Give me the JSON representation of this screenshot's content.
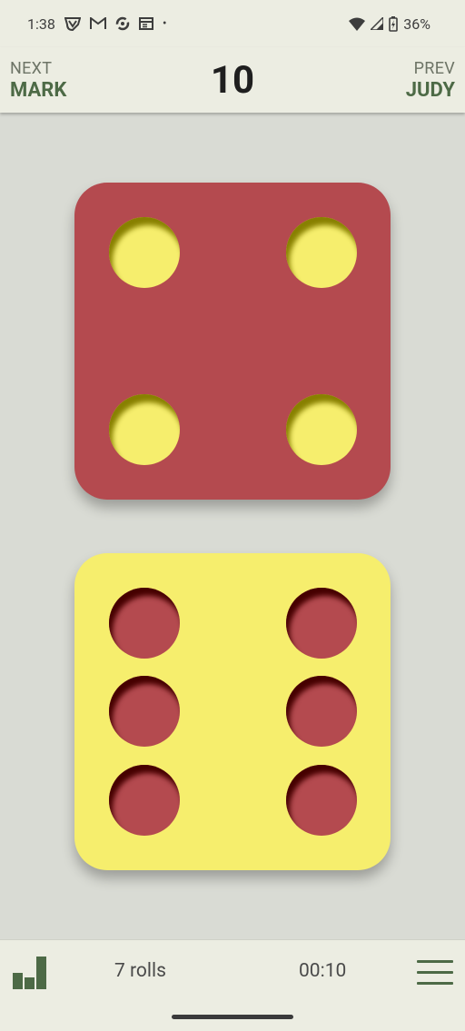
{
  "status_bar": {
    "time": "1:38",
    "icons": [
      "shield-v-icon",
      "gmail-icon",
      "sync-icon",
      "calendar-icon",
      "dot-icon"
    ],
    "dot": "•",
    "battery_percent": "36%"
  },
  "header": {
    "next_caption": "NEXT",
    "next_player": "MARK",
    "total": "10",
    "prev_caption": "PREV",
    "prev_player": "JUDY"
  },
  "dice": [
    {
      "name": "red-die",
      "value": 4,
      "face_color": "#b44a4f",
      "pip_color": "#f6ee6d"
    },
    {
      "name": "yellow-die",
      "value": 6,
      "face_color": "#f6ee6d",
      "pip_color": "#b44a4f"
    }
  ],
  "bottom_bar": {
    "rolls": "7 rolls",
    "timer": "00:10"
  },
  "colors": {
    "accent": "#4d6a46",
    "background": "#d9dbd4",
    "bar": "#ecede2"
  }
}
